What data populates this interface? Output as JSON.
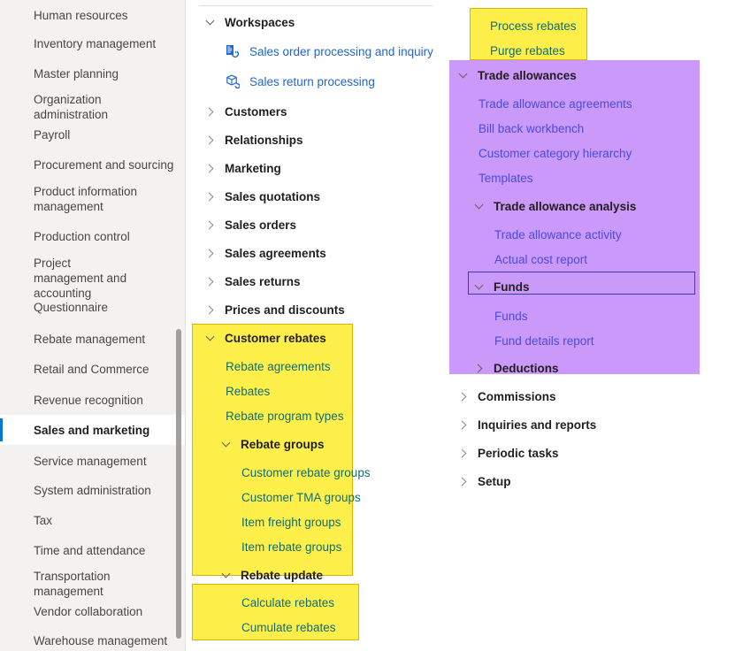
{
  "module_sidebar": {
    "items": [
      {
        "label": "Human resources",
        "selected": false
      },
      {
        "label": "Inventory management",
        "selected": false
      },
      {
        "label": "Master planning",
        "selected": false
      },
      {
        "label": "Organization administration",
        "selected": false
      },
      {
        "label": "Payroll",
        "selected": false
      },
      {
        "label": "Procurement and sourcing",
        "selected": false
      },
      {
        "label": "Product information management",
        "selected": false
      },
      {
        "label": "Production control",
        "selected": false
      },
      {
        "label": "Project management and accounting",
        "selected": false
      },
      {
        "label": "Questionnaire",
        "selected": false
      },
      {
        "label": "Rebate management",
        "selected": false
      },
      {
        "label": "Retail and Commerce",
        "selected": false
      },
      {
        "label": "Revenue recognition",
        "selected": false
      },
      {
        "label": "Sales and marketing",
        "selected": true
      },
      {
        "label": "Service management",
        "selected": false
      },
      {
        "label": "System administration",
        "selected": false
      },
      {
        "label": "Tax",
        "selected": false
      },
      {
        "label": "Time and attendance",
        "selected": false
      },
      {
        "label": "Transportation management",
        "selected": false
      },
      {
        "label": "Vendor collaboration",
        "selected": false
      },
      {
        "label": "Warehouse management",
        "selected": false
      }
    ]
  },
  "middle_column": {
    "workspaces": {
      "label": "Workspaces",
      "expanded": true,
      "children": [
        {
          "label": "Sales order processing and inquiry",
          "icon": "sales-order-workspace-icon"
        },
        {
          "label": "Sales return processing",
          "icon": "sales-return-workspace-icon"
        }
      ]
    },
    "collapsed_groups": [
      {
        "label": "Customers"
      },
      {
        "label": "Relationships"
      },
      {
        "label": "Marketing"
      },
      {
        "label": "Sales quotations"
      },
      {
        "label": "Sales orders"
      },
      {
        "label": "Sales agreements"
      },
      {
        "label": "Sales returns"
      },
      {
        "label": "Prices and discounts"
      }
    ],
    "customer_rebates": {
      "label": "Customer rebates",
      "expanded": true,
      "children": [
        {
          "label": "Rebate agreements"
        },
        {
          "label": "Rebates"
        },
        {
          "label": "Rebate program types"
        }
      ],
      "rebate_groups": {
        "label": "Rebate groups",
        "expanded": true,
        "children": [
          {
            "label": "Customer rebate groups"
          },
          {
            "label": "Customer TMA groups"
          },
          {
            "label": "Item freight groups"
          },
          {
            "label": "Item rebate groups"
          }
        ]
      },
      "rebate_update": {
        "label": "Rebate update",
        "expanded": true,
        "children": [
          {
            "label": "Calculate rebates"
          },
          {
            "label": "Cumulate rebates"
          }
        ]
      }
    }
  },
  "right_column": {
    "rebate_process_items": [
      {
        "label": "Process rebates"
      },
      {
        "label": "Purge rebates"
      }
    ],
    "trade_allowances": {
      "label": "Trade allowances",
      "expanded": true,
      "children": [
        {
          "label": "Trade allowance agreements"
        },
        {
          "label": "Bill back workbench"
        },
        {
          "label": "Customer category hierarchy"
        },
        {
          "label": "Templates"
        }
      ],
      "trade_allowance_analysis": {
        "label": "Trade allowance analysis",
        "expanded": true,
        "children": [
          {
            "label": "Trade allowance activity"
          },
          {
            "label": "Actual cost report"
          }
        ]
      },
      "funds": {
        "label": "Funds",
        "expanded": true,
        "focused": true,
        "children": [
          {
            "label": "Funds"
          },
          {
            "label": "Fund details report"
          }
        ]
      },
      "deductions": {
        "label": "Deductions",
        "expanded": false
      }
    },
    "collapsed_groups": [
      {
        "label": "Commissions"
      },
      {
        "label": "Inquiries and reports"
      },
      {
        "label": "Periodic tasks"
      },
      {
        "label": "Setup"
      }
    ]
  },
  "colors": {
    "highlight_yellow": "#ffef4a",
    "highlight_yellow_border": "#e0b100",
    "highlight_purple": "#cb99fa",
    "focus_border": "#3b3bb5",
    "selection_accent": "#0078d4",
    "link_teal": "#106e6e",
    "link_blue": "#2266cc",
    "link_violet": "#4b4bdd"
  }
}
